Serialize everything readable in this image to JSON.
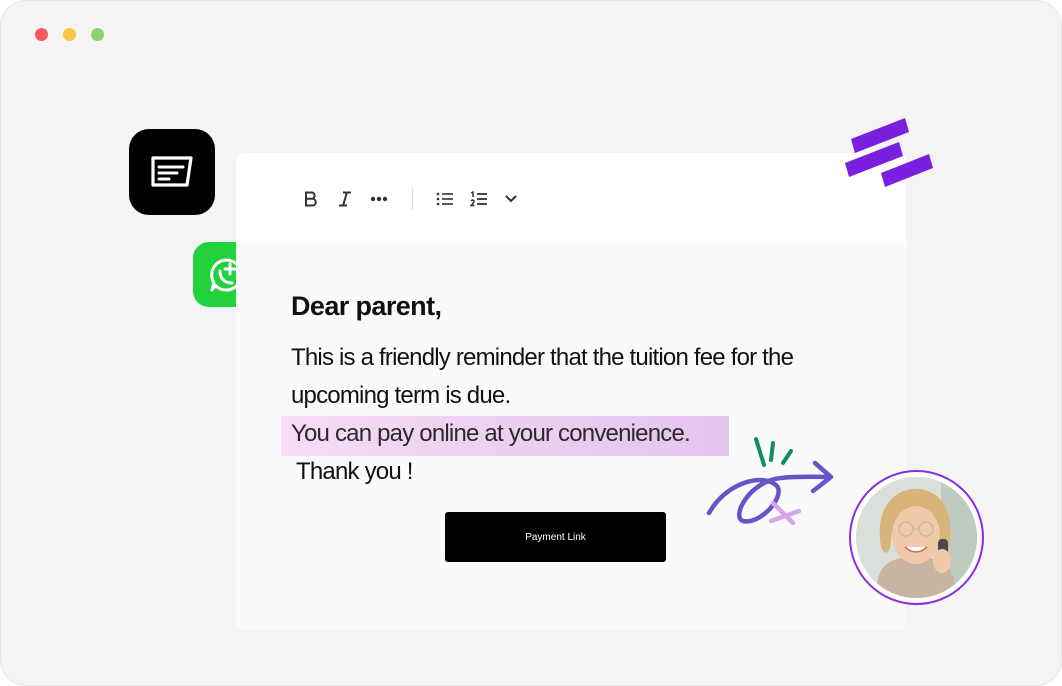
{
  "window": {
    "controls": [
      "close",
      "minimize",
      "maximize"
    ]
  },
  "toolbar": {
    "icons": [
      "bold-icon",
      "italic-icon",
      "more-icon",
      "bullet-list-icon",
      "numbered-list-icon",
      "chevron-down-icon"
    ]
  },
  "message": {
    "greeting": "Dear parent,",
    "line1": "This is a friendly reminder that the tuition fee for the",
    "line2": "upcoming term is due.",
    "line3": "You can pay online at your convenience.",
    "line4": "Thank you !"
  },
  "button": {
    "label": "Payment Link"
  },
  "colors": {
    "brand_purple": "#7a1fe0",
    "whatsapp_green": "#22d13c",
    "highlight": "#f0d2f0",
    "avatar_ring": "#8a2ce0"
  },
  "apps": [
    "message-app-icon",
    "whatsapp-icon",
    "brand-logo"
  ]
}
